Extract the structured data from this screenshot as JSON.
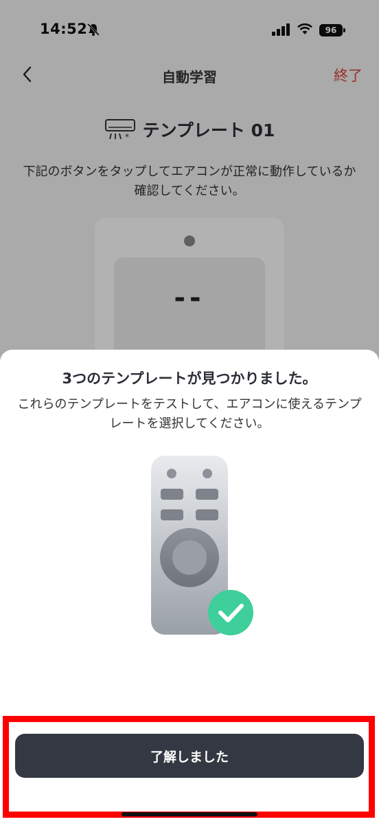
{
  "status_bar": {
    "time": "14:52",
    "battery": "96",
    "icons": [
      "bell-slash-icon",
      "signal-icon",
      "wifi-icon",
      "battery-icon"
    ]
  },
  "nav": {
    "title": "自動学習",
    "done_label": "終了",
    "back_icon": "chevron-left-icon"
  },
  "template": {
    "name": "テンプレート 01",
    "icon": "air-conditioner-icon"
  },
  "background_description": "下記のボタンをタップしてエアコンが正常に動作しているか確認してください。",
  "remote_display": "--",
  "sheet": {
    "title": "3つのテンプレートが見つかりました。",
    "description": "これらのテンプレートをテストして、エアコンに使えるテンプレートを選択してください。",
    "illustration": "remote-with-check-icon",
    "button_label": "了解しました"
  },
  "colors": {
    "accent_red": "#d9403a",
    "button_dark": "#333842",
    "check_green": "#3ecf9a",
    "highlight_red": "#ff0000"
  }
}
